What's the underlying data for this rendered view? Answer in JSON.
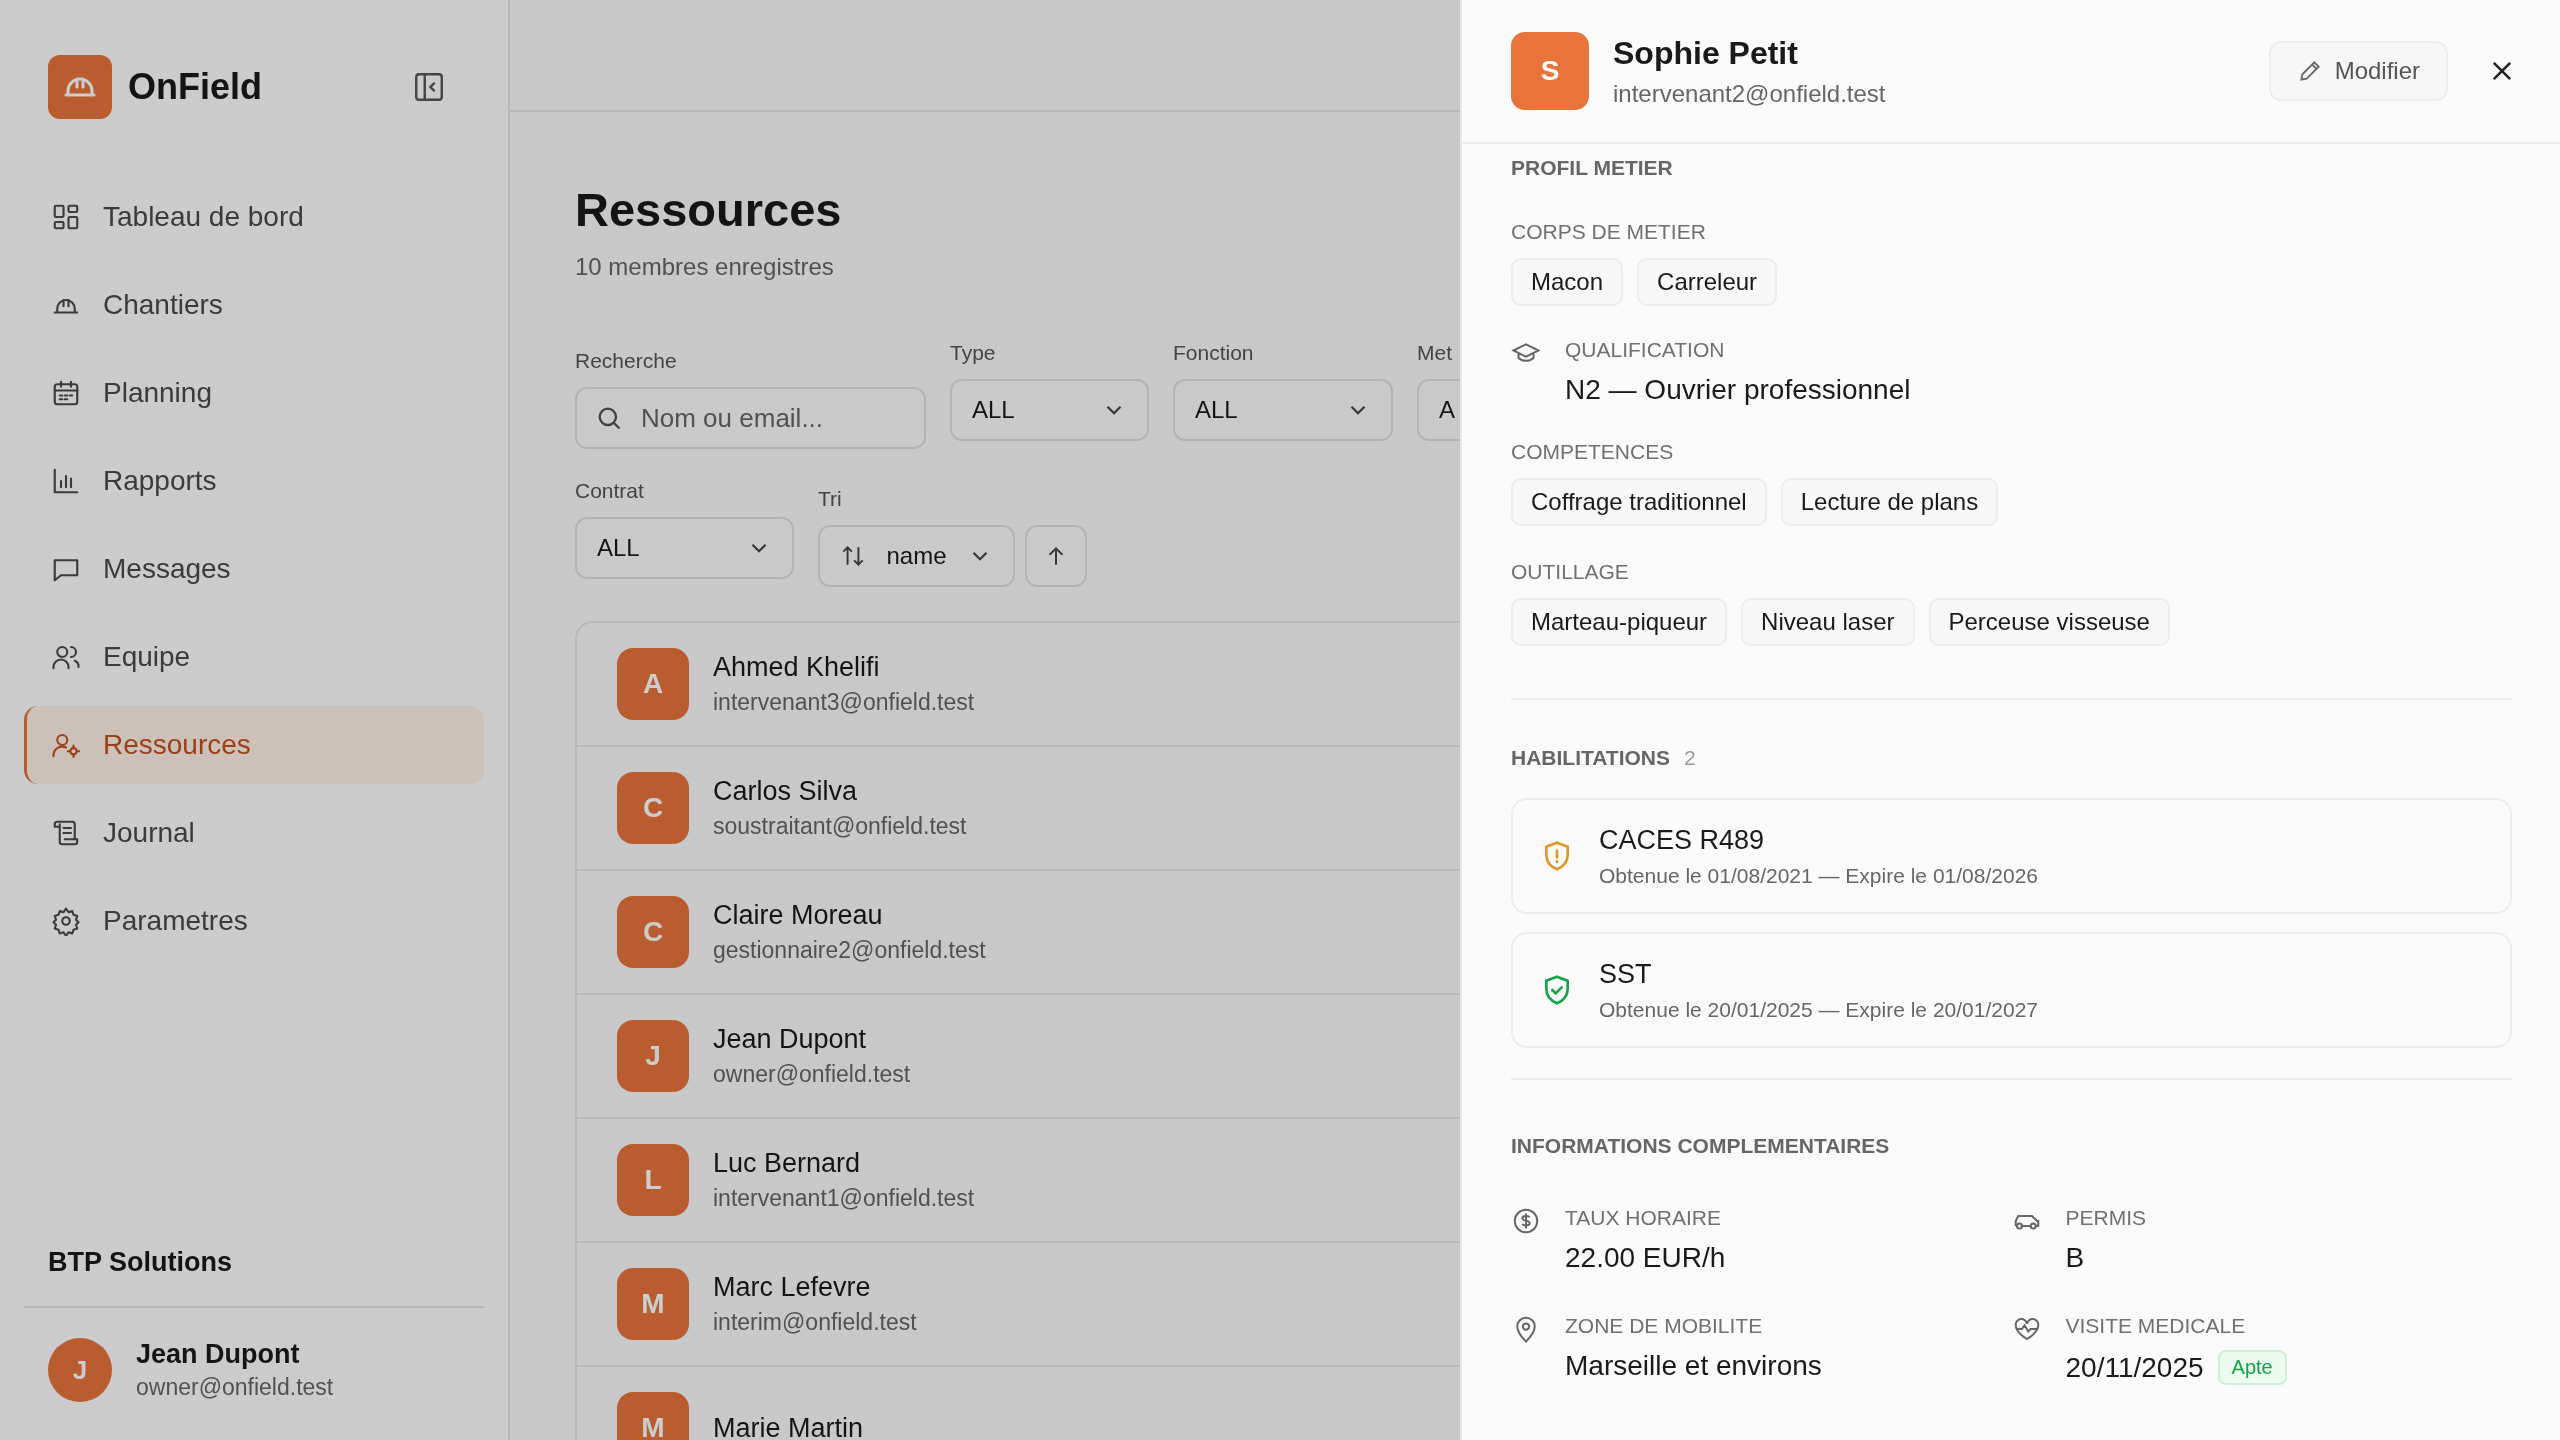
{
  "sidebar": {
    "logo": "OnField",
    "items": [
      {
        "label": "Tableau de bord",
        "selected": false
      },
      {
        "label": "Chantiers",
        "selected": false
      },
      {
        "label": "Planning",
        "selected": false
      },
      {
        "label": "Rapports",
        "selected": false
      },
      {
        "label": "Messages",
        "selected": false
      },
      {
        "label": "Equipe",
        "selected": false
      },
      {
        "label": "Ressources",
        "selected": true
      },
      {
        "label": "Journal",
        "selected": false
      },
      {
        "label": "Parametres",
        "selected": false
      }
    ],
    "company": "BTP Solutions",
    "user": {
      "initial": "J",
      "name": "Jean Dupont",
      "email": "owner@onfield.test"
    }
  },
  "page": {
    "title": "Ressources",
    "subtitle": "10 membres enregistres",
    "search": {
      "label": "Recherche",
      "placeholder": "Nom ou email..."
    },
    "filters": [
      {
        "label": "Type",
        "value": "ALL"
      },
      {
        "label": "Fonction",
        "value": "ALL"
      },
      {
        "label": "Met",
        "value": "A"
      }
    ],
    "contract": {
      "label": "Contrat",
      "value": "ALL"
    },
    "sort": {
      "label": "Tri",
      "value": "name"
    },
    "members": [
      {
        "initial": "A",
        "name": "Ahmed Khelifi",
        "email": "intervenant3@onfield.test"
      },
      {
        "initial": "C",
        "name": "Carlos Silva",
        "email": "soustraitant@onfield.test"
      },
      {
        "initial": "C",
        "name": "Claire Moreau",
        "email": "gestionnaire2@onfield.test"
      },
      {
        "initial": "J",
        "name": "Jean Dupont",
        "email": "owner@onfield.test"
      },
      {
        "initial": "L",
        "name": "Luc Bernard",
        "email": "intervenant1@onfield.test"
      },
      {
        "initial": "M",
        "name": "Marc Lefevre",
        "email": "interim@onfield.test"
      },
      {
        "initial": "M",
        "name": "Marie Martin"
      }
    ]
  },
  "drawer": {
    "initial": "S",
    "name": "Sophie Petit",
    "email": "intervenant2@onfield.test",
    "edit_button": "Modifier",
    "section": "PROFIL METIER",
    "trades_label": "CORPS DE METIER",
    "trades": [
      "Macon",
      "Carreleur"
    ],
    "qualification": {
      "label": "QUALIFICATION",
      "value": "N2 — Ouvrier professionnel"
    },
    "skills_label": "COMPETENCES",
    "skills": [
      "Coffrage traditionnel",
      "Lecture de plans"
    ],
    "tools_label": "OUTILLAGE",
    "tools": [
      "Marteau-piqueur",
      "Niveau laser",
      "Perceuse visseuse"
    ],
    "habilitations": {
      "title": "HABILITATIONS",
      "count": "2",
      "items": [
        {
          "kind": "warning",
          "name": "CACES R489",
          "dates": "Obtenue le 01/08/2021 — Expire le 01/08/2026"
        },
        {
          "kind": "valid",
          "name": "SST",
          "dates": "Obtenue le 20/01/2025 — Expire le 20/01/2027"
        }
      ]
    },
    "info": {
      "title": "INFORMATIONS COMPLEMENTAIRES",
      "fields": [
        {
          "kind": "rate",
          "label": "TAUX HORAIRE",
          "value": "22.00 EUR/h"
        },
        {
          "kind": "license",
          "label": "PERMIS",
          "value": "B"
        },
        {
          "kind": "zone",
          "label": "ZONE DE MOBILITE",
          "value": "Marseille et environs"
        },
        {
          "kind": "medical",
          "label": "VISITE MEDICALE",
          "value": "20/11/2025",
          "badge": "Apte"
        }
      ]
    }
  }
}
